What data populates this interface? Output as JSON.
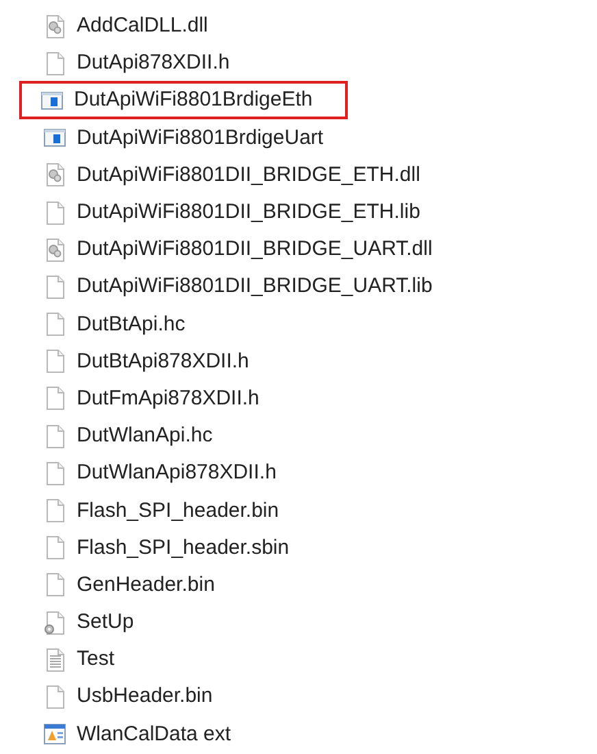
{
  "files": [
    {
      "name": "AddCalDLL.dll",
      "kind": "dll",
      "highlighted": false
    },
    {
      "name": "DutApi878XDII.h",
      "kind": "file",
      "highlighted": false
    },
    {
      "name": "DutApiWiFi8801BrdigeEth",
      "kind": "app",
      "highlighted": true
    },
    {
      "name": "DutApiWiFi8801BrdigeUart",
      "kind": "app",
      "highlighted": false
    },
    {
      "name": "DutApiWiFi8801DII_BRIDGE_ETH.dll",
      "kind": "dll",
      "highlighted": false
    },
    {
      "name": "DutApiWiFi8801DII_BRIDGE_ETH.lib",
      "kind": "file",
      "highlighted": false
    },
    {
      "name": "DutApiWiFi8801DII_BRIDGE_UART.dll",
      "kind": "dll",
      "highlighted": false
    },
    {
      "name": "DutApiWiFi8801DII_BRIDGE_UART.lib",
      "kind": "file",
      "highlighted": false
    },
    {
      "name": "DutBtApi.hc",
      "kind": "file",
      "highlighted": false
    },
    {
      "name": "DutBtApi878XDII.h",
      "kind": "file",
      "highlighted": false
    },
    {
      "name": "DutFmApi878XDII.h",
      "kind": "file",
      "highlighted": false
    },
    {
      "name": "DutWlanApi.hc",
      "kind": "file",
      "highlighted": false
    },
    {
      "name": "DutWlanApi878XDII.h",
      "kind": "file",
      "highlighted": false
    },
    {
      "name": "Flash_SPI_header.bin",
      "kind": "file",
      "highlighted": false
    },
    {
      "name": "Flash_SPI_header.sbin",
      "kind": "file",
      "highlighted": false
    },
    {
      "name": "GenHeader.bin",
      "kind": "file",
      "highlighted": false
    },
    {
      "name": "SetUp",
      "kind": "setup",
      "highlighted": false
    },
    {
      "name": "Test",
      "kind": "text",
      "highlighted": false
    },
    {
      "name": "UsbHeader.bin",
      "kind": "file",
      "highlighted": false
    },
    {
      "name": "WlanCalData ext",
      "kind": "image",
      "highlighted": false
    }
  ]
}
